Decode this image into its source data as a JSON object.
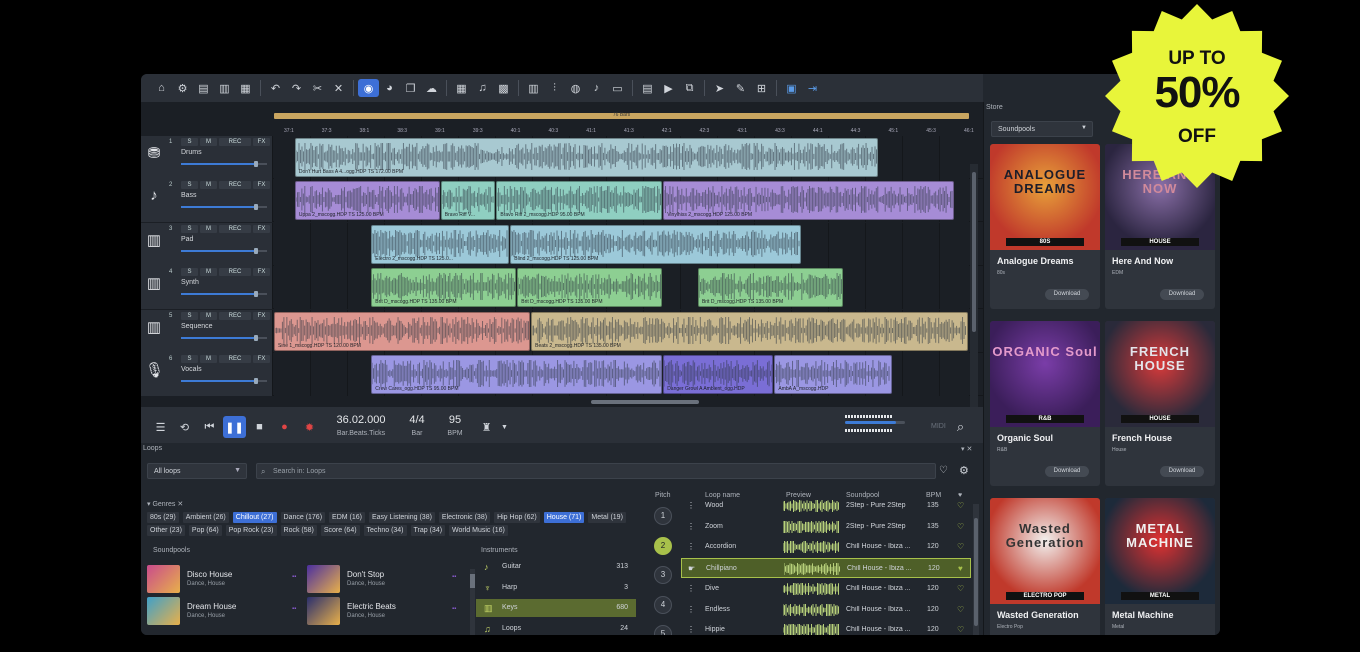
{
  "toolbar_icons": [
    "home-icon",
    "gear-icon",
    "new-file-icon",
    "open-file-icon",
    "save-icon",
    "undo-icon",
    "redo-icon",
    "cut-icon",
    "delete-icon",
    "snap-icon",
    "bounce-icon",
    "copy-icon",
    "upload-icon",
    "grid-icon",
    "note-icon",
    "tiles-icon",
    "keyboard-icon",
    "mixer-icon",
    "fx-icon",
    "score-icon",
    "monitor-icon",
    "text-icon",
    "video-icon",
    "split-icon",
    "pointer-icon",
    "pencil-icon",
    "zoom-icon",
    "screen-icon",
    "export-icon"
  ],
  "arrange": {
    "overview_label": "76 Bars",
    "ruler": [
      "37:1",
      "37:3",
      "38:1",
      "38:3",
      "39:1",
      "39:3",
      "40:1",
      "40:3",
      "41:1",
      "41:3",
      "42:1",
      "42:3",
      "43:1",
      "43:3",
      "44:1",
      "44:3",
      "45:1",
      "45:3",
      "46:1"
    ],
    "track_buttons": {
      "solo": "S",
      "mute": "M",
      "rec": "REC",
      "fx": "FX"
    },
    "tracks": [
      {
        "num": "1",
        "name": "Drums",
        "icon": "drum-icon",
        "clips": [
          {
            "label": "Don't Hurt Bass A 4...ogg.HDP  TS  172.00 BPM",
            "start": 0.03,
            "end": 0.87,
            "color": "#a8c9d1"
          }
        ]
      },
      {
        "num": "2",
        "name": "Bass",
        "icon": "guitar-icon",
        "clips": [
          {
            "label": "Uppa 2_mscogg.HDP  TS  125.00 BPM",
            "start": 0.03,
            "end": 0.24,
            "color": "#a68cd6"
          },
          {
            "label": "Bravo Riff V...",
            "start": 0.24,
            "end": 0.32,
            "color": "#8fcfc1"
          },
          {
            "label": "Bravo Riff 2_mscogg.HDP  95.00 BPM",
            "start": 0.32,
            "end": 0.56,
            "color": "#8fcfc1"
          },
          {
            "label": "Vinylhiss 2_mscogg.HDP  125.00 BPM",
            "start": 0.56,
            "end": 0.98,
            "color": "#a68cd6"
          }
        ]
      },
      {
        "num": "3",
        "name": "Pad",
        "icon": "piano-icon",
        "clips": [
          {
            "label": "Electro 2_mscogg.HDP  TS  125.0...",
            "start": 0.14,
            "end": 0.34,
            "color": "#9cc9d9"
          },
          {
            "label": "Blind 2_mscogg.HDP  TS  125.00 BPM",
            "start": 0.34,
            "end": 0.76,
            "color": "#9cc9d9"
          }
        ]
      },
      {
        "num": "4",
        "name": "Synth",
        "icon": "piano-icon",
        "clips": [
          {
            "label": "Brit D_mscogg.HDP  TS  135.00 BPM",
            "start": 0.14,
            "end": 0.35,
            "color": "#8dcf92"
          },
          {
            "label": "Brit D_mscogg.HDP  TS  135.00 BPM",
            "start": 0.35,
            "end": 0.56,
            "color": "#8dcf92"
          },
          {
            "label": "Brit D_mscogg.HDP  TS  135.00 BPM",
            "start": 0.61,
            "end": 0.82,
            "color": "#8dcf92"
          }
        ]
      },
      {
        "num": "5",
        "name": "Sequence",
        "icon": "piano-icon",
        "clips": [
          {
            "label": "Sine 1_mscogg.HDP  TS  120.00 BPM",
            "start": 0.0,
            "end": 0.37,
            "color": "#dc9790"
          },
          {
            "label": "Beats 2_mscogg.HDP  TS  135.00 BPM",
            "start": 0.37,
            "end": 1.0,
            "color": "#c9b88e"
          }
        ]
      },
      {
        "num": "6",
        "name": "Vocals",
        "icon": "mic-icon",
        "clips": [
          {
            "label": "Crew Cares_ogg.HDP  TS  95.00 BPM",
            "start": 0.14,
            "end": 0.56,
            "color": "#9b97e3"
          },
          {
            "label": "Danger Growl A Ambient_ogg.HDP",
            "start": 0.56,
            "end": 0.72,
            "color": "#7a6ed6"
          },
          {
            "label": "AmbA A_mscogg.HDP",
            "start": 0.72,
            "end": 0.89,
            "color": "#9b97e3"
          }
        ]
      }
    ]
  },
  "transport": {
    "position": "36.02.000",
    "position_label": "Bar.Beats.Ticks",
    "signature": "4/4",
    "signature_label": "Bar",
    "tempo": "95",
    "tempo_label": "BPM",
    "midi": "MIDI",
    "volume": 0.85
  },
  "loops": {
    "title": "Loops",
    "filter": "All loops",
    "search_placeholder": "Search in: Loops",
    "genres_header": "Genres",
    "genres": [
      {
        "label": "80s (29)",
        "selected": false
      },
      {
        "label": "Ambient (26)",
        "selected": false
      },
      {
        "label": "Chillout (27)",
        "selected": true
      },
      {
        "label": "Dance (176)",
        "selected": false
      },
      {
        "label": "EDM (16)",
        "selected": false
      },
      {
        "label": "Easy Listening (38)",
        "selected": false
      },
      {
        "label": "Electronic (38)",
        "selected": false
      },
      {
        "label": "Hip Hop (62)",
        "selected": false
      },
      {
        "label": "House (71)",
        "selected": true
      },
      {
        "label": "Metal (19)",
        "selected": false
      },
      {
        "label": "Other (23)",
        "selected": false
      },
      {
        "label": "Pop (64)",
        "selected": false
      },
      {
        "label": "Pop Rock (23)",
        "selected": false
      },
      {
        "label": "Rock (58)",
        "selected": false
      },
      {
        "label": "Score (64)",
        "selected": false
      },
      {
        "label": "Techno (34)",
        "selected": false
      },
      {
        "label": "Trap (34)",
        "selected": false
      },
      {
        "label": "World Music (16)",
        "selected": false
      }
    ],
    "soundpools_header": "Soundpools",
    "soundpools": [
      {
        "name": "Disco House",
        "genre": "Dance, House",
        "color": "#c94b8c"
      },
      {
        "name": "Don't Stop",
        "genre": "Dance, House",
        "color": "#4b2fa0"
      },
      {
        "name": "Dream House",
        "genre": "Dance, House",
        "color": "#3fa0c9"
      },
      {
        "name": "Electric Beats",
        "genre": "Dance, House",
        "color": "#2a2f6e"
      }
    ],
    "instruments_header": "Instruments",
    "instruments": [
      {
        "name": "Guitar",
        "count": "313",
        "icon": "guitar-icon",
        "selected": false
      },
      {
        "name": "Harp",
        "count": "3",
        "icon": "harp-icon",
        "selected": false
      },
      {
        "name": "Keys",
        "count": "680",
        "icon": "piano-icon",
        "selected": true
      },
      {
        "name": "Loops",
        "count": "24",
        "icon": "note-icon",
        "selected": false
      }
    ],
    "columns": {
      "pitch": "Pitch",
      "name": "Loop name",
      "preview": "Preview",
      "soundpool": "Soundpool",
      "bpm": "BPM"
    },
    "pitches": [
      "1",
      "2",
      "3",
      "4",
      "5"
    ],
    "rows": [
      {
        "name": "Wood",
        "soundpool": "2Step - Pure 2Step",
        "bpm": "135",
        "selected": false
      },
      {
        "name": "Zoom",
        "soundpool": "2Step - Pure 2Step",
        "bpm": "135",
        "selected": false
      },
      {
        "name": "Accordion",
        "soundpool": "Chill House - Ibiza ...",
        "bpm": "120",
        "selected": false
      },
      {
        "name": "Chillpiano",
        "soundpool": "Chill House - Ibiza ...",
        "bpm": "120",
        "selected": true
      },
      {
        "name": "Dive",
        "soundpool": "Chill House - Ibiza ...",
        "bpm": "120",
        "selected": false
      },
      {
        "name": "Endless",
        "soundpool": "Chill House - Ibiza ...",
        "bpm": "120",
        "selected": false
      },
      {
        "name": "Hippie",
        "soundpool": "Chill House - Ibiza ...",
        "bpm": "120",
        "selected": false
      }
    ]
  },
  "store": {
    "title": "Store",
    "dropdown": "Soundpools",
    "download_label": "Download",
    "cards": [
      {
        "title": "Analogue Dreams",
        "genre": "80s",
        "tag": "80S",
        "cover_text": "ANALOGUE DREAMS",
        "colors": [
          "#e8a13a",
          "#c0392b",
          "#1d1d2a"
        ]
      },
      {
        "title": "Here And Now",
        "genre": "EDM",
        "tag": "HOUSE",
        "cover_text": "HERE AND NOW",
        "colors": [
          "#8a6fa8",
          "#2b2540",
          "#d18a9b"
        ]
      },
      {
        "title": "Organic Soul",
        "genre": "R&B",
        "tag": "R&B",
        "cover_text": "ORGANIC Soul",
        "colors": [
          "#7a3da8",
          "#3b1e5a",
          "#e49acb"
        ]
      },
      {
        "title": "French House",
        "genre": "House",
        "tag": "HOUSE",
        "cover_text": "FRENCH HOUSE",
        "colors": [
          "#d93a3a",
          "#2a2a3a",
          "#e4e4ea"
        ]
      },
      {
        "title": "Wasted Generation",
        "genre": "Electro Pop",
        "tag": "ELECTRO POP",
        "cover_text": "Wasted Generation",
        "colors": [
          "#f2f0ee",
          "#c0392b",
          "#333"
        ]
      },
      {
        "title": "Metal Machine",
        "genre": "Metal",
        "tag": "METAL",
        "cover_text": "METAL MACHINE",
        "colors": [
          "#e03131",
          "#1d2a3a",
          "#f0f0f0"
        ]
      }
    ]
  },
  "promo": {
    "line1": "UP TO",
    "line2": "50%",
    "line3": "OFF",
    "color": "#e8f53a"
  }
}
